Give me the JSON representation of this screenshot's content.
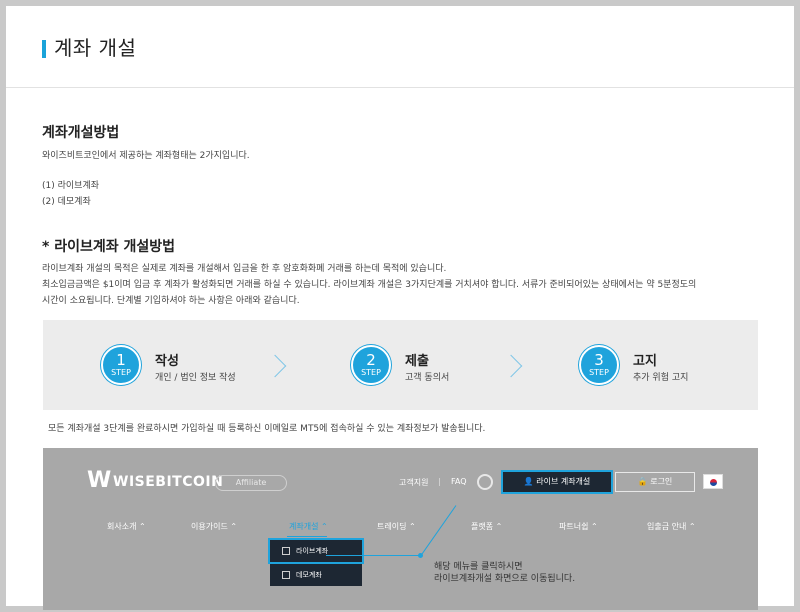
{
  "page": {
    "title": "계좌 개설"
  },
  "section1": {
    "heading": "계좌개설방법",
    "intro": "와이즈비트코인에서 제공하는 계좌형태는 2가지입니다.",
    "types": [
      "(1) 라이브계좌",
      "(2) 데모계좌"
    ]
  },
  "section2": {
    "heading": "* 라이브계좌 개설방법",
    "lines": [
      "라이브계좌 개설의 목적은 실제로 계좌를 개설해서 입금을 한 후 암호화화폐 거래를 하는데 목적에 있습니다.",
      "최소입금금액은 $1이며 입금 후 계좌가 활성화되면 거래를 하실 수 있습니다. 라이브계좌 개설은 3가지단계를 거치셔야 합니다. 서류가 준비되어있는 상태에서는 약 5분정도의",
      "시간이 소요됩니다. 단계별 기입하셔야 하는 사항은 아래와 같습니다."
    ]
  },
  "steps": [
    {
      "num": "1",
      "label": "STEP",
      "title": "작성",
      "desc": "개인 / 법인 정보 작성"
    },
    {
      "num": "2",
      "label": "STEP",
      "title": "제출",
      "desc": "고객 동의서"
    },
    {
      "num": "3",
      "label": "STEP",
      "title": "고지",
      "desc": "추가 위험 고지"
    }
  ],
  "after_steps": "모든 계좌개설 3단계를 완료하시면 가입하실 때 등록하신 이메일로 MT5에 접속하실 수 있는 계좌정보가 발송됩니다.",
  "screenshot": {
    "logo_text": "WISEBITCOIN",
    "affiliate": "Affiliate",
    "support": "고객지원",
    "separator": "|",
    "faq": "FAQ",
    "live_account_btn": "라이브 계좌개설",
    "login_btn": "로그인",
    "nav": [
      "회사소개 ⌃",
      "이용가이드 ⌃",
      "계좌개설 ⌃",
      "트레이딩 ⌃",
      "플랫폼 ⌃",
      "파트너쉽 ⌃",
      "입출금 안내 ⌃"
    ],
    "dropdown": [
      "라이브계좌",
      "데모계좌"
    ]
  },
  "callout": {
    "line1": "해당 메뉴를 클릭하시면",
    "line2": "라이브계좌개설 화면으로 이동됩니다."
  },
  "colors": {
    "accent": "#1fa3dc",
    "dark_button": "#1d2733",
    "screenshot_bg": "#a8a8a8",
    "step_panel": "#ececec"
  }
}
